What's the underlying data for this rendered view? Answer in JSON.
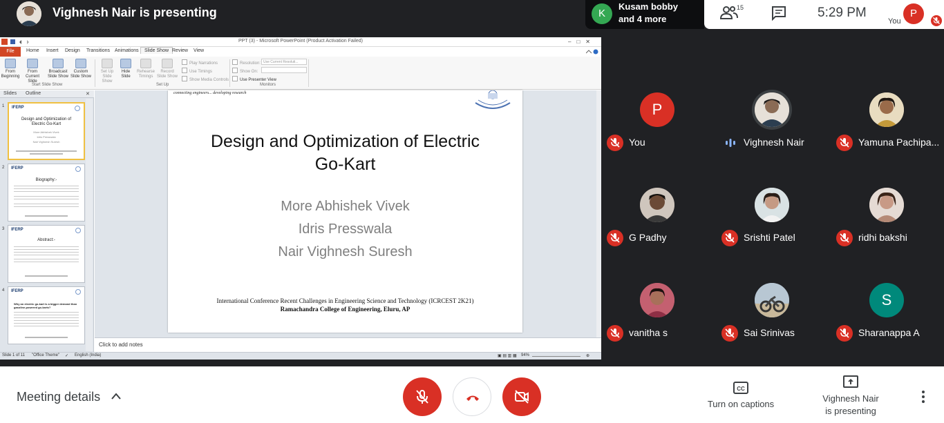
{
  "topbar": {
    "presenter_title": "Vighnesh Nair is presenting",
    "others_initial": "K",
    "others_name_line1": "Kusam bobby",
    "others_name_line2": "and 4 more",
    "people_count": "15",
    "time": "5:29  PM",
    "self_initial": "P",
    "self_label": "You"
  },
  "ppt": {
    "window_title": "PPT (3)  -  Microsoft PowerPoint (Product Activation Failed)",
    "file_tab": "File",
    "tabs": [
      "Home",
      "Insert",
      "Design",
      "Transitions",
      "Animations",
      "Slide Show",
      "Review",
      "View"
    ],
    "ribbon": {
      "from_beginning": "From Beginning",
      "from_current": "From Current Slide",
      "broadcast": "Broadcast Slide Show",
      "custom": "Custom Slide Show",
      "setup": "Set Up Slide Show",
      "hide": "Hide Slide",
      "rehearse": "Rehearse Timings",
      "record": "Record Slide Show",
      "play_narrations": "Play Narrations",
      "use_timings": "Use Timings",
      "show_media": "Show Media Controls",
      "resolution_label": "Resolution:",
      "resolution_value": "Use Current Resoluti...",
      "show_on_label": "Show On:",
      "presenter_view": "Use Presenter View",
      "group_start": "Start Slide Show",
      "group_setup": "Set Up",
      "group_monitors": "Monitors"
    },
    "pane_tabs": [
      "Slides",
      "Outline"
    ],
    "thumbs": [
      {
        "num": "1",
        "logo": "IFERP",
        "head": "Design and Optimization of Electric Go-Kart",
        "authors": [
          "More Abhishek Vivek",
          "Idris Presswala",
          "Nair Vighnesh Suresh"
        ]
      },
      {
        "num": "2",
        "logo": "IFERP",
        "head": "Biography:-"
      },
      {
        "num": "3",
        "logo": "IFERP",
        "head": "Abstract:-"
      },
      {
        "num": "4",
        "logo": "IFERP",
        "head": "Why an electric go-kart is a bigger demand than gasoline-powered go-karts?"
      }
    ],
    "slide": {
      "tagline": "connecting engineers... developing research",
      "title_line1": "Design and Optimization of Electric",
      "title_line2": "Go-Kart",
      "authors": [
        "More Abhishek Vivek",
        "Idris Presswala",
        "Nair Vighnesh Suresh"
      ],
      "conference": "International  Conference Recent Challenges  in Engineering  Science and Technology (ICRCEST 2K21)",
      "college": "Ramachandra  College of Engineering, Eluru, AP"
    },
    "notes_placeholder": "Click to add notes",
    "status": {
      "slide_count": "Slide 1 of 11",
      "theme": "\"Office Theme\"",
      "language": "English (India)",
      "zoom": "94%"
    }
  },
  "participants": [
    {
      "name": "You",
      "initial": "P",
      "color": "#d93025",
      "muted": true
    },
    {
      "name": "Vighnesh Nair",
      "initial": "",
      "color": "#c9b8a6",
      "muted": false
    },
    {
      "name": "Yamuna Pachipa...",
      "initial": "",
      "color": "#d8c49a",
      "muted": true
    },
    {
      "name": "G Padhy",
      "initial": "",
      "color": "#7a6a5e",
      "muted": true
    },
    {
      "name": "Srishti Patel",
      "initial": "",
      "color": "#d7cdc3",
      "muted": true
    },
    {
      "name": "ridhi bakshi",
      "initial": "",
      "color": "#cdb9ad",
      "muted": true
    },
    {
      "name": "vanitha s",
      "initial": "",
      "color": "#b05a66",
      "muted": true
    },
    {
      "name": "Sai Srinivas",
      "initial": "",
      "color": "#9bb0c4",
      "muted": true
    },
    {
      "name": "Sharanappa A",
      "initial": "S",
      "color": "#00897b",
      "muted": true
    }
  ],
  "bottombar": {
    "meeting_details": "Meeting details",
    "captions_label": "Turn on captions",
    "presenting_line1": "Vighnesh Nair",
    "presenting_line2": "is presenting"
  },
  "colors": {
    "meet_bg": "#202124",
    "danger": "#d93025",
    "speaking": "#8ab4f8"
  }
}
